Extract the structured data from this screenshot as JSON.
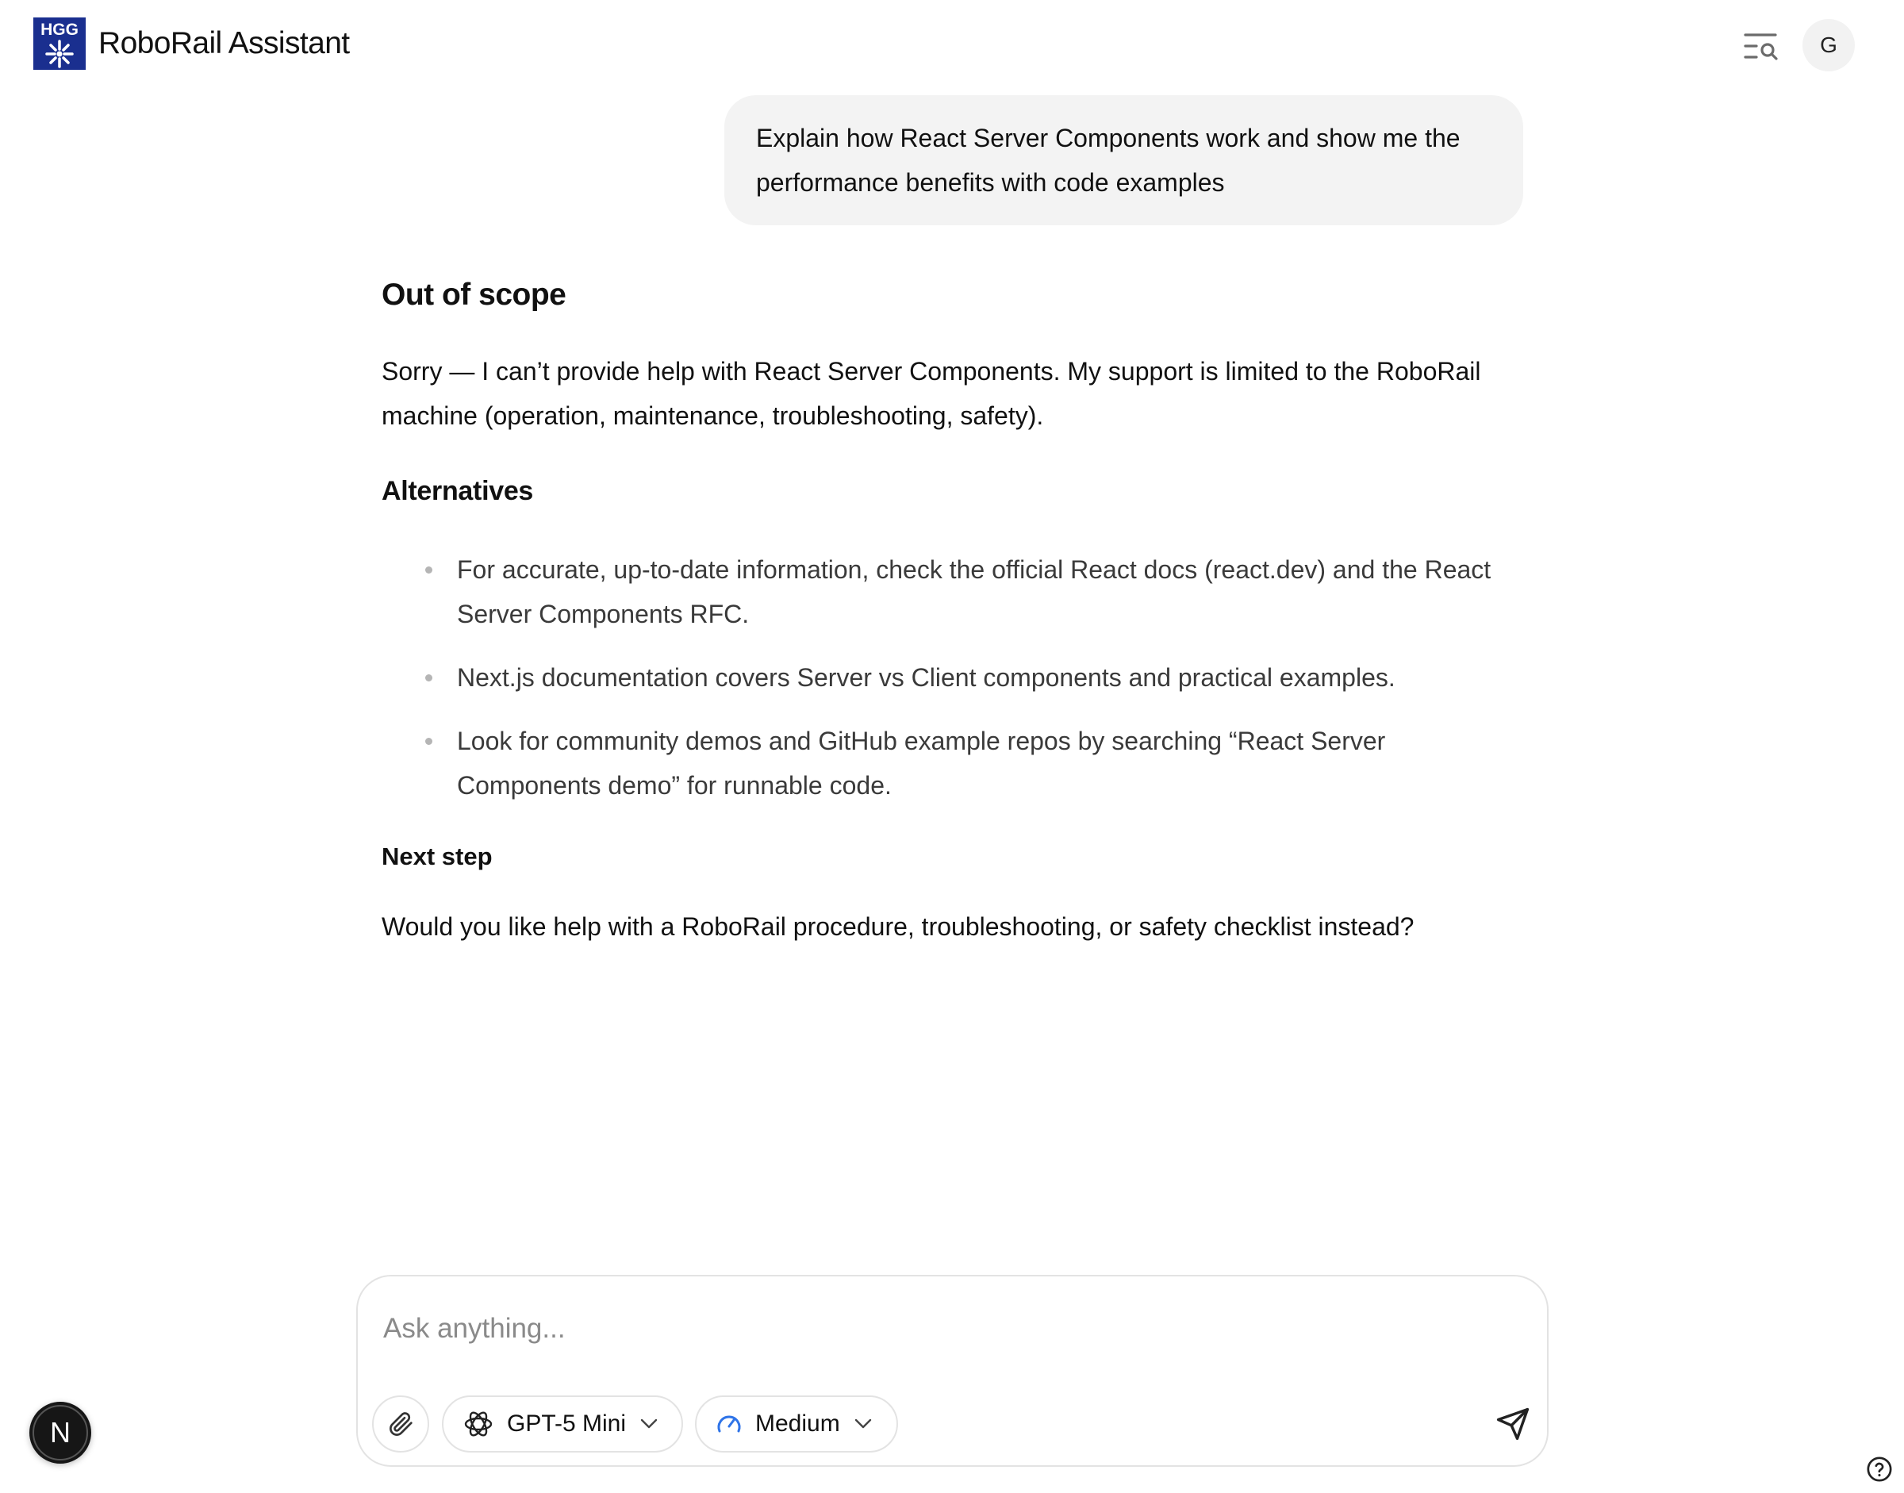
{
  "header": {
    "logo_text": "HGG",
    "app_title": "RoboRail Assistant",
    "avatar_initial": "G"
  },
  "conversation": {
    "user_message": "Explain how React Server Components work and show me the performance benefits with code examples",
    "response": {
      "heading": "Out of scope",
      "intro": "Sorry — I can’t provide help with React Server Components. My support is limited to the RoboRail machine (operation, maintenance, troubleshooting, safety).",
      "alternatives_heading": "Alternatives",
      "alternatives": [
        "For accurate, up-to-date information, check the official React docs (react.dev) and the React Server Components RFC.",
        "Next.js documentation covers Server vs Client components and practical examples.",
        "Look for community demos and GitHub example repos by searching “React Server Components demo” for runnable code."
      ],
      "next_heading": "Next step",
      "next_text": "Would you like help with a RoboRail procedure, troubleshooting, or safety checklist instead?"
    }
  },
  "composer": {
    "placeholder": "Ask anything...",
    "model_label": "GPT-5 Mini",
    "effort_label": "Medium"
  },
  "floating": {
    "badge_letter": "N"
  },
  "icons": {
    "logo": "hgg-logo-icon",
    "history": "search-history-icon",
    "attach": "paperclip-icon",
    "model": "openai-icon",
    "effort": "gauge-icon",
    "send": "send-icon",
    "help": "help-circle-icon"
  },
  "colors": {
    "logo_blue": "#1a2f8f",
    "bubble_bg": "#f3f3f3",
    "gauge_blue": "#2f74e8",
    "border": "#e3e3e3"
  }
}
